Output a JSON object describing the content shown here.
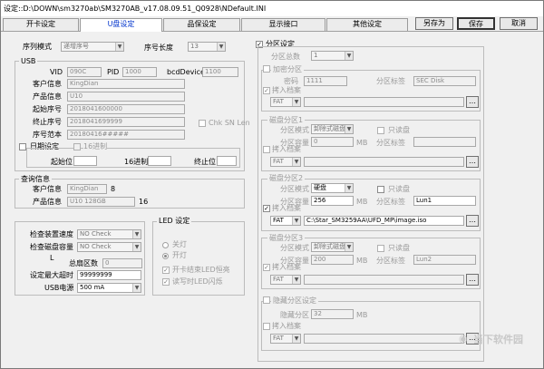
{
  "window": {
    "title": "设定::D:\\DOWN\\sm3270ab\\SM3270AB_v17.08.09.51_Q0928\\NDefault.INI"
  },
  "tabs": [
    "开卡设定",
    "U盘设定",
    "品保设定",
    "显示接口",
    "其他设定"
  ],
  "buttons": {
    "save_as": "另存为",
    "save": "保存",
    "cancel": "取消"
  },
  "serial": {
    "mode_label": "序列模式",
    "mode_value": "递增序号",
    "length_label": "序号长度",
    "length_value": "13"
  },
  "usb": {
    "group": "USB",
    "vid_label": "VID",
    "vid": "090C",
    "pid_label": "PID",
    "pid": "1000",
    "bcd_label": "bcdDevice",
    "bcd": "1100",
    "cust_label": "客户信息",
    "cust": "KingDian",
    "prod_label": "产品信息",
    "prod": "U10",
    "start_label": "起始序号",
    "start": "2018041600000",
    "end_label": "终止序号",
    "end": "2018041699999",
    "sample_label": "序号范本",
    "sample": "20180416#####",
    "chk_sn_len": "Chk SN Len",
    "date_label": "日期设定",
    "hex16": "16进制",
    "start_pos": "起始位",
    "hex16_b": "16进制",
    "end_pos": "终止位"
  },
  "query": {
    "group": "查询信息",
    "cust_label": "客户信息",
    "cust": "KingDian",
    "cust_len": "8",
    "prod_label": "产品信息",
    "prod": "U10 128GB",
    "prod_len": "16"
  },
  "check": {
    "speed_label": "检查装置速度",
    "speed": "NO Check",
    "disk_label": "检查磁盘容量",
    "disk": "NO Check",
    "L": "L",
    "total_label": "总扇区数",
    "total": "0",
    "timeout_label": "设定最大超时",
    "timeout": "99999999",
    "power_label": "USB电源",
    "power": "500 mA"
  },
  "led": {
    "group": "LED 设定",
    "off": "关灯",
    "on": "开灯",
    "opt1": "开卡结束LED恒亮",
    "opt2": "读写时LED闪烁"
  },
  "partition": {
    "group": "分区设定",
    "total_label": "分区总数",
    "total": "1",
    "enc": {
      "group": "加密分区",
      "pwd_label": "密码",
      "pwd": "1111",
      "tag_label": "分区标签",
      "tag": "SEC Disk",
      "load": "拷入档案",
      "fs": "FAT"
    },
    "d1": {
      "group": "磁盘分区1",
      "mode_label": "分区模式",
      "mode": "卸除式磁盘",
      "ro": "只读盘",
      "cap_label": "分区容量",
      "cap": "0",
      "unit": "MB",
      "tag_label": "分区标签",
      "tag": "",
      "load": "拷入档案",
      "fs": "FAT"
    },
    "d2": {
      "group": "磁盘分区2",
      "mode_label": "分区模式",
      "mode": "硬盘",
      "ro": "只读盘",
      "cap_label": "分区容量",
      "cap": "256",
      "unit": "MB",
      "tag_label": "分区标签",
      "tag": "Lun1",
      "load": "拷入档案",
      "fs": "FAT",
      "path": "C:\\Star_SM3259AA\\UFD_MP\\image.iso"
    },
    "d3": {
      "group": "磁盘分区3",
      "mode_label": "分区模式",
      "mode": "卸除式磁盘",
      "ro": "只读盘",
      "cap_label": "分区容量",
      "cap": "200",
      "unit": "MB",
      "tag_label": "分区标签",
      "tag": "Lun2",
      "load": "拷入档案",
      "fs": "FAT"
    },
    "hidden": {
      "group": "隐藏分区设定",
      "cap_label": "隐藏分区",
      "cap": "32",
      "unit": "MB",
      "load": "拷入档案",
      "fs": "FAT"
    }
  },
  "watermark": "当下软件园"
}
